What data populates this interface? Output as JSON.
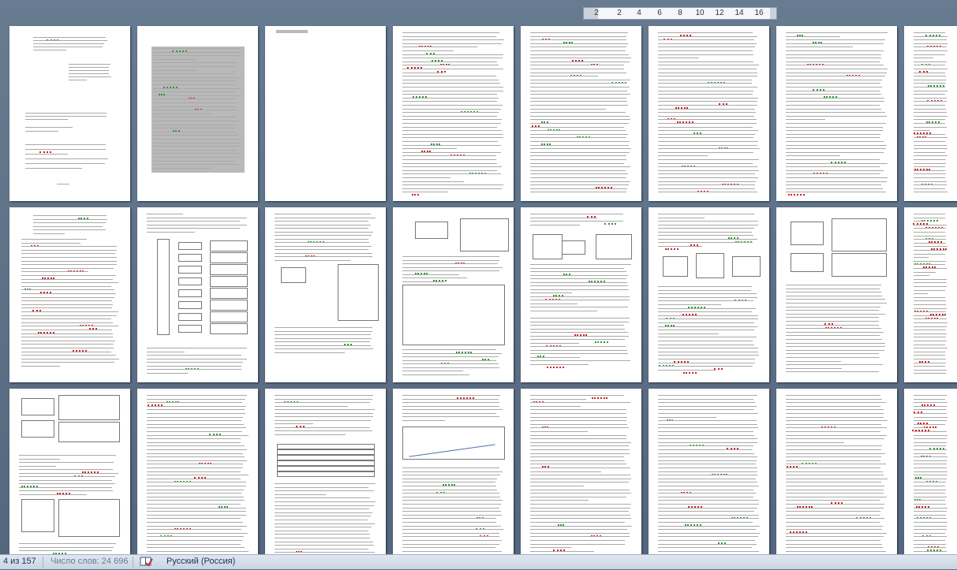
{
  "ruler": {
    "labels": [
      "2",
      "2",
      "4",
      "6",
      "8",
      "10",
      "12",
      "14",
      "16"
    ]
  },
  "statusbar": {
    "page_info": "4 из 157",
    "word_count": "Число слов: 24 696",
    "language": "Русский (Россия)",
    "proofing_icon": "book-check-icon"
  },
  "colors": {
    "background": "#5c6f85",
    "page": "#ffffff",
    "statusbar": "#d6e0ec",
    "spellcheck_red": "#d22020",
    "grammar_green": "#2e9a2e"
  }
}
